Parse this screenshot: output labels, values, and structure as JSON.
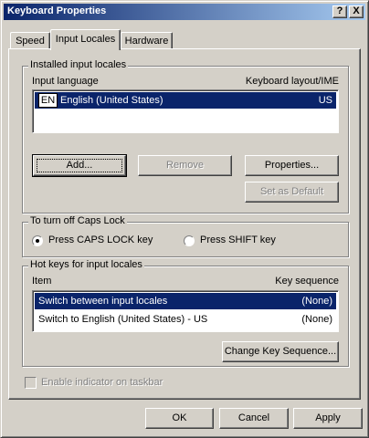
{
  "window": {
    "title": "Keyboard Properties",
    "help_glyph": "?",
    "close_glyph": "X"
  },
  "tabs": [
    {
      "label": "Speed",
      "active": false
    },
    {
      "label": "Input Locales",
      "active": true
    },
    {
      "label": "Hardware",
      "active": false
    }
  ],
  "installed": {
    "group_label": "Installed input locales",
    "col_language": "Input language",
    "col_layout": "Keyboard layout/IME",
    "rows": [
      {
        "badge": "EN",
        "language": "English (United States)",
        "layout": "US",
        "selected": true
      }
    ],
    "add_label": "Add...",
    "remove_label": "Remove",
    "properties_label": "Properties...",
    "set_default_label": "Set as Default"
  },
  "caps_lock": {
    "group_label": "To turn off Caps Lock",
    "option_caps": "Press CAPS LOCK key",
    "option_shift": "Press SHIFT key",
    "selected": "caps"
  },
  "hotkeys": {
    "group_label": "Hot keys for input locales",
    "col_item": "Item",
    "col_sequence": "Key sequence",
    "rows": [
      {
        "item": "Switch between input locales",
        "sequence": "(None)",
        "selected": true
      },
      {
        "item": "Switch to English (United States) - US",
        "sequence": "(None)",
        "selected": false
      }
    ],
    "change_label": "Change Key Sequence..."
  },
  "taskbar_checkbox": {
    "label": "Enable indicator on taskbar",
    "checked": false,
    "enabled": false
  },
  "footer": {
    "ok_label": "OK",
    "cancel_label": "Cancel",
    "apply_label": "Apply"
  }
}
